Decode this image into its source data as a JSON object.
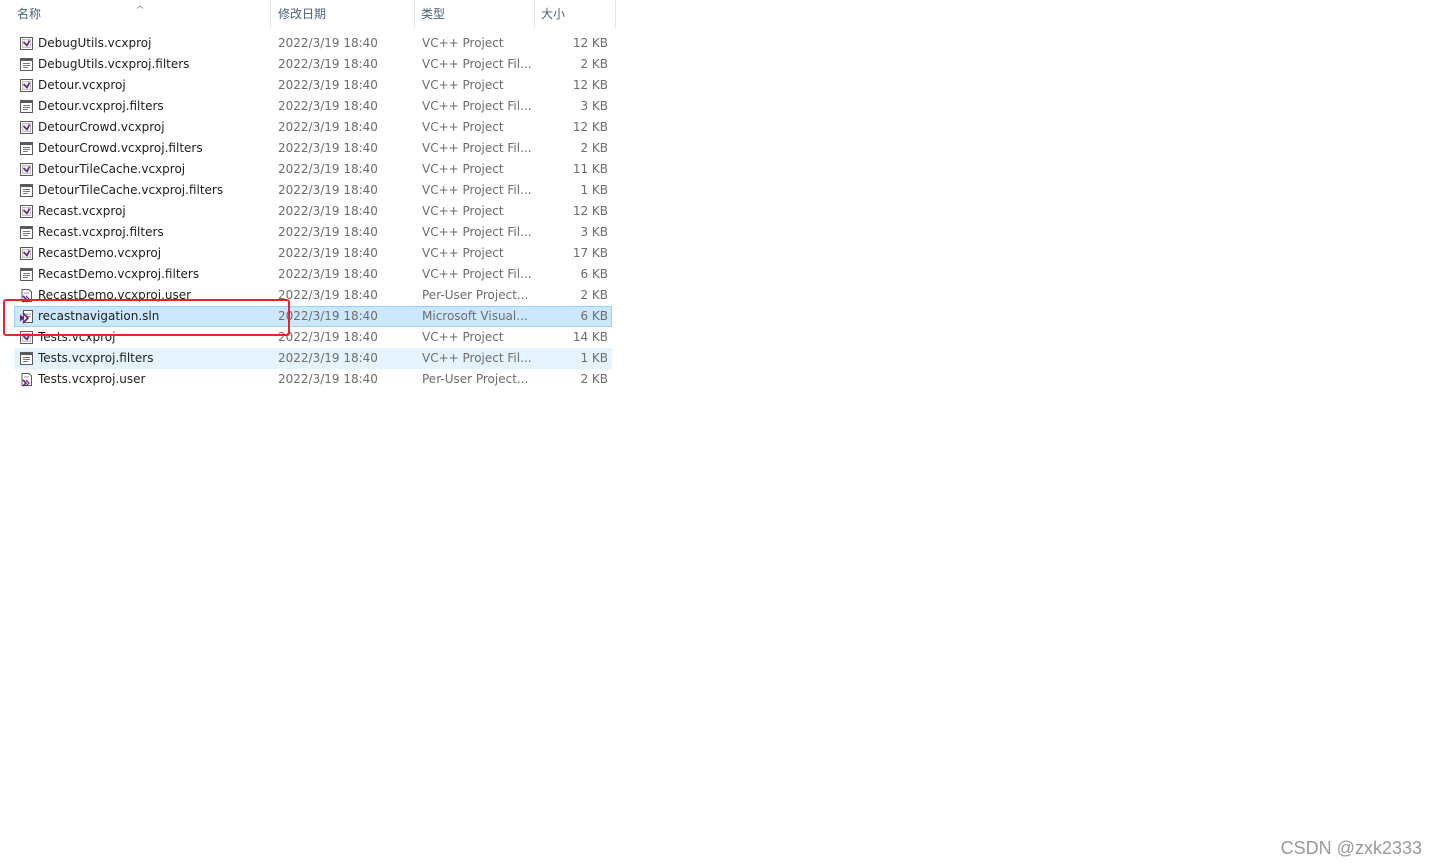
{
  "columns": {
    "name": "名称",
    "date": "修改日期",
    "type": "类型",
    "size": "大小",
    "sort_indicator": "^"
  },
  "files": [
    {
      "name": "DebugUtils.vcxproj",
      "date": "2022/3/19 18:40",
      "type": "VC++ Project",
      "size": "12 KB",
      "icon": "vcxproj-icon"
    },
    {
      "name": "DebugUtils.vcxproj.filters",
      "date": "2022/3/19 18:40",
      "type": "VC++ Project Fil...",
      "size": "2 KB",
      "icon": "filters-file-icon"
    },
    {
      "name": "Detour.vcxproj",
      "date": "2022/3/19 18:40",
      "type": "VC++ Project",
      "size": "12 KB",
      "icon": "vcxproj-icon"
    },
    {
      "name": "Detour.vcxproj.filters",
      "date": "2022/3/19 18:40",
      "type": "VC++ Project Fil...",
      "size": "3 KB",
      "icon": "filters-file-icon"
    },
    {
      "name": "DetourCrowd.vcxproj",
      "date": "2022/3/19 18:40",
      "type": "VC++ Project",
      "size": "12 KB",
      "icon": "vcxproj-icon"
    },
    {
      "name": "DetourCrowd.vcxproj.filters",
      "date": "2022/3/19 18:40",
      "type": "VC++ Project Fil...",
      "size": "2 KB",
      "icon": "filters-file-icon"
    },
    {
      "name": "DetourTileCache.vcxproj",
      "date": "2022/3/19 18:40",
      "type": "VC++ Project",
      "size": "11 KB",
      "icon": "vcxproj-icon"
    },
    {
      "name": "DetourTileCache.vcxproj.filters",
      "date": "2022/3/19 18:40",
      "type": "VC++ Project Fil...",
      "size": "1 KB",
      "icon": "filters-file-icon"
    },
    {
      "name": "Recast.vcxproj",
      "date": "2022/3/19 18:40",
      "type": "VC++ Project",
      "size": "12 KB",
      "icon": "vcxproj-icon"
    },
    {
      "name": "Recast.vcxproj.filters",
      "date": "2022/3/19 18:40",
      "type": "VC++ Project Fil...",
      "size": "3 KB",
      "icon": "filters-file-icon"
    },
    {
      "name": "RecastDemo.vcxproj",
      "date": "2022/3/19 18:40",
      "type": "VC++ Project",
      "size": "17 KB",
      "icon": "vcxproj-icon"
    },
    {
      "name": "RecastDemo.vcxproj.filters",
      "date": "2022/3/19 18:40",
      "type": "VC++ Project Fil...",
      "size": "6 KB",
      "icon": "filters-file-icon"
    },
    {
      "name": "RecastDemo.vcxproj.user",
      "date": "2022/3/19 18:40",
      "type": "Per-User Project...",
      "size": "2 KB",
      "icon": "user-file-icon"
    },
    {
      "name": "recastnavigation.sln",
      "date": "2022/3/19 18:40",
      "type": "Microsoft Visual...",
      "size": "6 KB",
      "icon": "sln-file-icon",
      "state": "selected"
    },
    {
      "name": "Tests.vcxproj",
      "date": "2022/3/19 18:40",
      "type": "VC++ Project",
      "size": "14 KB",
      "icon": "vcxproj-icon"
    },
    {
      "name": "Tests.vcxproj.filters",
      "date": "2022/3/19 18:40",
      "type": "VC++ Project Fil...",
      "size": "1 KB",
      "icon": "filters-file-icon",
      "state": "hover"
    },
    {
      "name": "Tests.vcxproj.user",
      "date": "2022/3/19 18:40",
      "type": "Per-User Project...",
      "size": "2 KB",
      "icon": "user-file-icon"
    }
  ],
  "colors": {
    "selected_bg": "#cce8ff",
    "hover_bg": "#e5f3ff",
    "annotation_box": "#e3262b",
    "vs_purple": "#68217a"
  },
  "watermark": "CSDN @zxk2333"
}
